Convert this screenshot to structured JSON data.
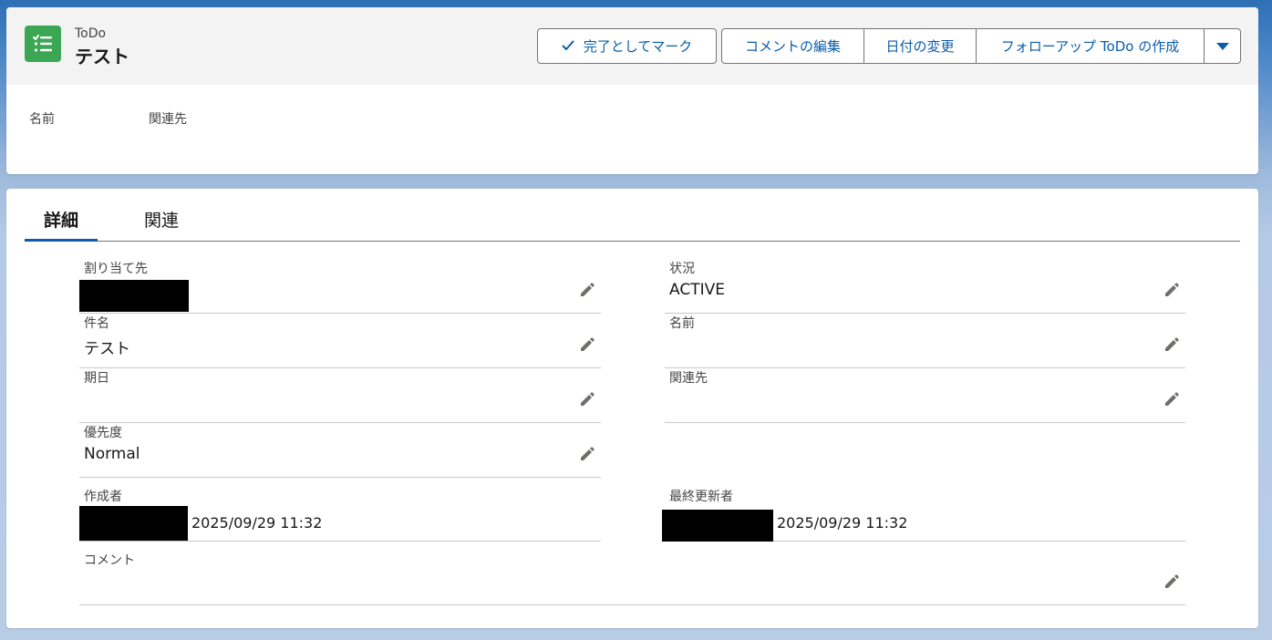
{
  "header": {
    "object_label": "ToDo",
    "record_title": "テスト",
    "icon": "task-list-icon",
    "accent_color": "#3ba755"
  },
  "actions": {
    "mark_complete": "完了としてマーク",
    "edit_comment": "コメントの編集",
    "change_date": "日付の変更",
    "create_followup": "フォローアップ ToDo の作成",
    "more_icon": "chevron-down-icon"
  },
  "highlights": {
    "name_label": "名前",
    "related_label": "関連先"
  },
  "tabs": [
    "詳細",
    "関連"
  ],
  "fields": {
    "assigned_to": {
      "label": "割り当て先",
      "value": ""
    },
    "subject": {
      "label": "件名",
      "value": "テスト"
    },
    "due_date": {
      "label": "期日",
      "value": ""
    },
    "priority": {
      "label": "優先度",
      "value": "Normal"
    },
    "created_by": {
      "label": "作成者",
      "timestamp": "2025/09/29 11:32"
    },
    "status": {
      "label": "状況",
      "value": "ACTIVE"
    },
    "name": {
      "label": "名前",
      "value": ""
    },
    "related_to": {
      "label": "関連先",
      "value": ""
    },
    "last_modified_by": {
      "label": "最終更新者",
      "timestamp": "2025/09/29 11:32"
    },
    "comment": {
      "label": "コメント",
      "value": ""
    }
  },
  "colors": {
    "brand_blue": "#0b5cab",
    "icon_green": "#3ba755"
  }
}
